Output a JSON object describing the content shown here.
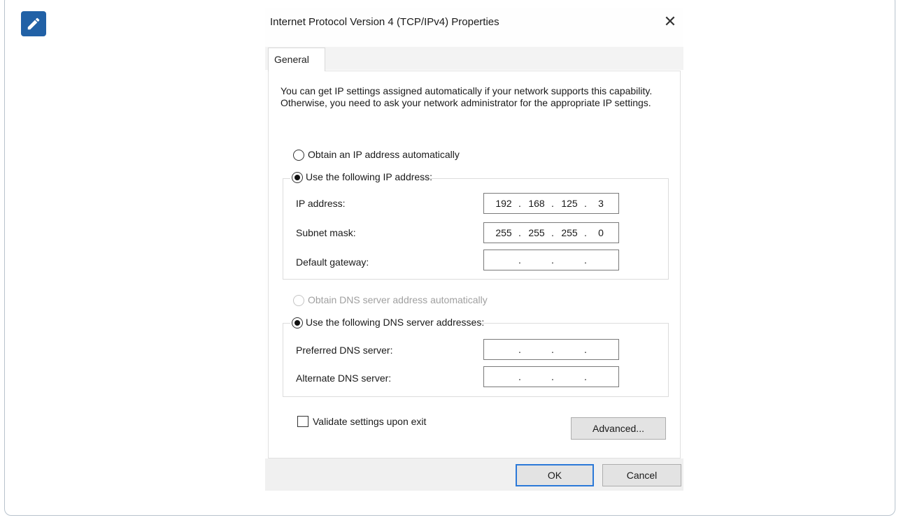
{
  "note_icon": "pencil-icon",
  "dialog": {
    "title": "Internet Protocol Version 4 (TCP/IPv4) Properties",
    "close_label": "✕",
    "tab_general": "General",
    "intro_text": "You can get IP settings assigned automatically if your network supports this capability. Otherwise, you need to ask your network administrator for the appropriate IP settings.",
    "ip_auto_label": "Obtain an IP address automatically",
    "ip_auto_selected": false,
    "ip_manual_label": "Use the following IP address:",
    "ip_manual_selected": true,
    "ip_address": {
      "label": "IP address:",
      "octets": [
        "192",
        "168",
        "125",
        "3"
      ]
    },
    "subnet_mask": {
      "label": "Subnet mask:",
      "octets": [
        "255",
        "255",
        "255",
        "0"
      ]
    },
    "default_gateway": {
      "label": "Default gateway:",
      "octets": [
        "",
        "",
        "",
        ""
      ]
    },
    "dns_auto_label": "Obtain DNS server address automatically",
    "dns_auto_enabled": false,
    "dns_manual_label": "Use the following DNS server addresses:",
    "dns_manual_selected": true,
    "preferred_dns": {
      "label": "Preferred DNS server:",
      "octets": [
        "",
        "",
        "",
        ""
      ]
    },
    "alternate_dns": {
      "label": "Alternate DNS server:",
      "octets": [
        "",
        "",
        "",
        ""
      ]
    },
    "validate_label": "Validate settings upon exit",
    "validate_checked": false,
    "advanced_button": "Advanced...",
    "ok_button": "OK",
    "cancel_button": "Cancel"
  }
}
